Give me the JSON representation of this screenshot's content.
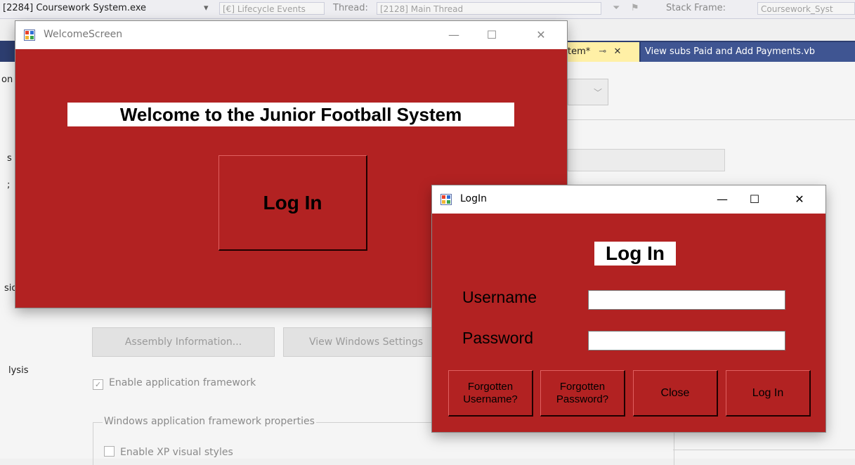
{
  "vs": {
    "process": "[2284] Coursework System.exe",
    "lifecycle": "[€] Lifecycle Events",
    "thread_label": "Thread:",
    "thread": "[2128] Main Thread",
    "stack_frame_label": "Stack Frame:",
    "stack_frame": "Coursework_Syst",
    "active_tab": "tem*",
    "other_tab": "View subs Paid and Add Payments.vb",
    "left_fragments": [
      "on",
      "s",
      ";",
      "sio",
      "lysis"
    ],
    "assembly_button": "Assembly Information...",
    "view_windows_button": "View Windows Settings",
    "enable_framework": "Enable application framework",
    "framework_group": "Windows application framework properties",
    "enable_xp": "Enable XP visual styles"
  },
  "welcome": {
    "title": "WelcomeScreen",
    "heading": "Welcome to the Junior Football System",
    "login_button": "Log In"
  },
  "login": {
    "title": "LogIn",
    "heading": "Log In",
    "username_label": "Username",
    "password_label": "Password",
    "username_value": "",
    "password_value": "",
    "buttons": {
      "forgot_username": "Forgotten Username?",
      "forgot_password": "Forgotten Password?",
      "close": "Close",
      "login": "Log In"
    }
  },
  "window_controls": {
    "minimize": "—",
    "maximize": "☐",
    "close": "✕"
  },
  "colors": {
    "form_background": "#b22222",
    "tab_active": "#fff0a6",
    "tab_bar": "#2d3e70"
  }
}
